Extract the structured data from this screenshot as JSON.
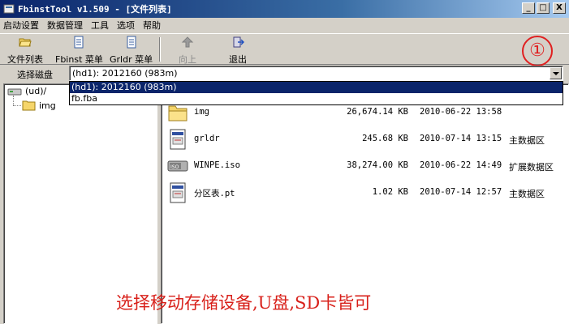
{
  "window": {
    "title": "FbinstTool v1.509 - [文件列表]",
    "controls": {
      "minimize": "_",
      "maximize": "□",
      "close": "X"
    }
  },
  "menu": [
    "启动设置",
    "数据管理",
    "工具",
    "选项",
    "帮助"
  ],
  "toolbar": {
    "file_list": "文件列表",
    "fbinst_menu": "Fbinst 菜单",
    "grldr_menu": "Grldr 菜单",
    "up": "向上",
    "exit": "退出"
  },
  "step_marker": "①",
  "disk": {
    "label": "选择磁盘",
    "selected": "(hd1): 2012160 (983m)",
    "options": [
      "(hd1): 2012160 (983m)",
      "fb.fba"
    ]
  },
  "tree": {
    "root": "(ud)/",
    "children": [
      "img"
    ]
  },
  "files": [
    {
      "name": "img",
      "size": "26,674.14 KB",
      "date": "2010-06-22 13:58",
      "area": "",
      "icon": "folder-icon"
    },
    {
      "name": "grldr",
      "size": "245.68 KB",
      "date": "2010-07-14 13:15",
      "area": "主数据区",
      "icon": "document-icon"
    },
    {
      "name": "WINPE.iso",
      "size": "38,274.00 KB",
      "date": "2010-06-22 14:49",
      "area": "扩展数据区",
      "icon": "iso-icon"
    },
    {
      "name": "分区表.pt",
      "size": "1.02 KB",
      "date": "2010-07-14 12:57",
      "area": "主数据区",
      "icon": "document-icon"
    }
  ],
  "annotation": "选择移动存储设备,U盘,SD卡皆可",
  "colors": {
    "title_start": "#0a246a",
    "title_end": "#a6caf0",
    "annotation": "#d8201a",
    "selection": "#0a246a"
  }
}
